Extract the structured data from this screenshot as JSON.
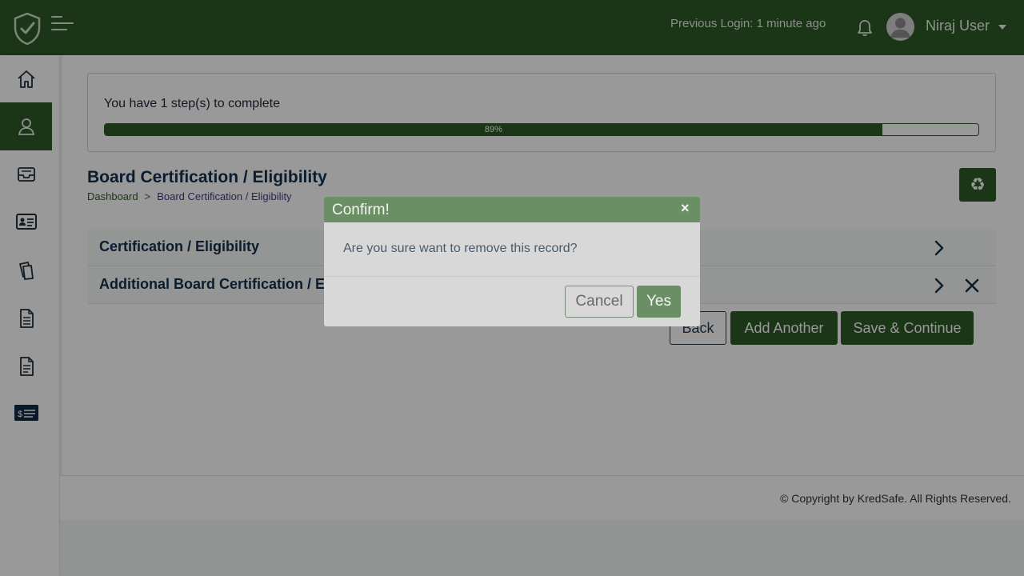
{
  "header": {
    "previous_login": "Previous Login: 1 minute ago",
    "user_name": "Niraj User",
    "brand_color": "#2d5a27"
  },
  "sidebar": {
    "items": [
      {
        "icon": "home-icon",
        "active": false
      },
      {
        "icon": "user-icon",
        "active": true
      },
      {
        "icon": "inbox-icon",
        "active": false
      },
      {
        "icon": "id-card-icon",
        "active": false
      },
      {
        "icon": "documents-icon",
        "active": false
      },
      {
        "icon": "file-icon",
        "active": false
      },
      {
        "icon": "file-text-icon",
        "active": false
      },
      {
        "icon": "billing-icon",
        "active": false
      }
    ]
  },
  "progress": {
    "text": "You have 1 step(s) to complete",
    "percent_label": "89%",
    "percent": 89
  },
  "page": {
    "title": "Board Certification / Eligibility",
    "breadcrumb": {
      "home": "Dashboard",
      "separator": ">",
      "current": "Board Certification / Eligibility"
    },
    "recycle_icon": "recycle-icon"
  },
  "sections": [
    {
      "label": "Certification / Eligibility"
    },
    {
      "label": "Additional Board Certification / Eligibility"
    }
  ],
  "actions": {
    "back": "Back",
    "add_another": "Add Another",
    "save_continue": "Save & Continue"
  },
  "footer": {
    "copyright": "© Copyright by KredSafe. All Rights Reserved."
  },
  "modal": {
    "title": "Confirm!",
    "close": "×",
    "message": "Are you sure want to remove this record?",
    "cancel": "Cancel",
    "yes": "Yes"
  }
}
